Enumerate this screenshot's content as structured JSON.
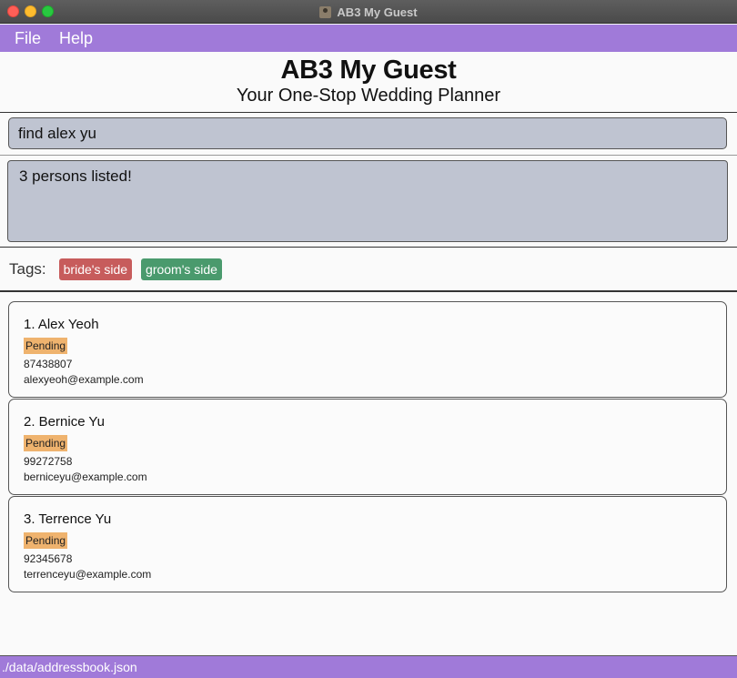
{
  "window": {
    "title": "AB3 My Guest"
  },
  "menu": {
    "items": [
      "File",
      "Help"
    ]
  },
  "header": {
    "title": "AB3 My Guest",
    "subtitle": "Your One-Stop Wedding Planner"
  },
  "command": {
    "value": "find alex yu"
  },
  "result": {
    "message": "3 persons listed!"
  },
  "tags": {
    "label": "Tags:",
    "items": [
      {
        "label": "bride's side",
        "color": "#c75c5c"
      },
      {
        "label": "groom's side",
        "color": "#4a9a6d"
      }
    ]
  },
  "persons": [
    {
      "name": "1. Alex Yeoh",
      "status": "Pending",
      "phone": "87438807",
      "email": "alexyeoh@example.com"
    },
    {
      "name": "2. Bernice Yu",
      "status": "Pending",
      "phone": "99272758",
      "email": "berniceyu@example.com"
    },
    {
      "name": "3. Terrence Yu",
      "status": "Pending",
      "phone": "92345678",
      "email": "terrenceyu@example.com"
    }
  ],
  "statusbar": {
    "path": "./data/addressbook.json"
  },
  "colors": {
    "accent": "#a07ad9",
    "input_bg": "#bfc4d1",
    "pending": "#efb36e"
  }
}
